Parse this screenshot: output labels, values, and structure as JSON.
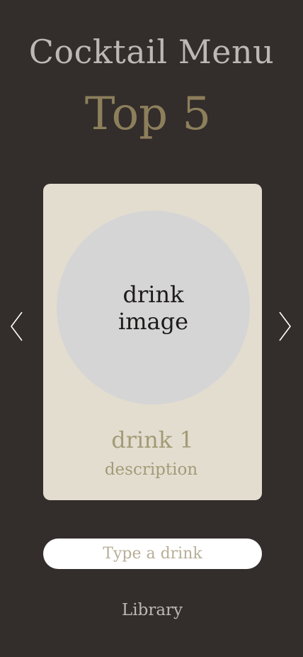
{
  "header": {
    "title": "Cocktail Menu",
    "subtitle": "Top 5"
  },
  "card": {
    "image_placeholder": "drink\nimage",
    "drink_name": "drink 1",
    "description": "description"
  },
  "nav": {
    "prev_icon": "chevron-left-icon",
    "next_icon": "chevron-right-icon"
  },
  "search": {
    "placeholder": "Type a drink"
  },
  "footer": {
    "library_label": "Library"
  },
  "colors": {
    "background": "#332d2b",
    "card": "#e3ddd0",
    "accent": "#8c7f5b",
    "muted_text": "#bdb8b4"
  }
}
